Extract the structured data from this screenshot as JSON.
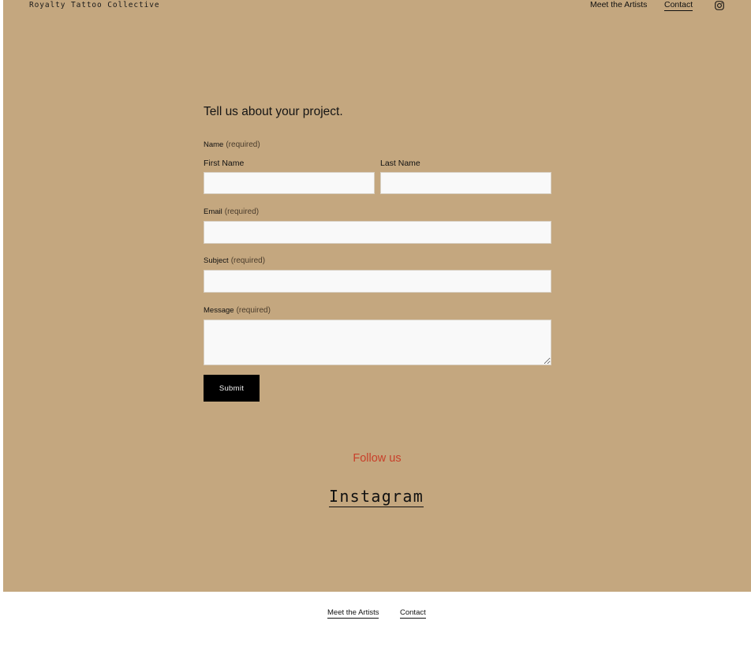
{
  "header": {
    "logo": "Royalty Tattoo Collective",
    "nav": {
      "artists": "Meet the Artists",
      "contact": "Contact"
    },
    "social_icon": "instagram-icon"
  },
  "form": {
    "title": "Tell us about your project.",
    "required_text": "(required)",
    "name": {
      "label": "Name",
      "first_label": "First Name",
      "last_label": "Last Name",
      "first_value": "",
      "last_value": ""
    },
    "email": {
      "label": "Email",
      "value": ""
    },
    "subject": {
      "label": "Subject",
      "value": ""
    },
    "message": {
      "label": "Message",
      "value": ""
    },
    "submit_label": "Submit"
  },
  "social": {
    "heading": "Follow us",
    "instagram_label": "Instagram"
  },
  "footer": {
    "artists": "Meet the Artists",
    "contact": "Contact"
  },
  "colors": {
    "background": "#c4a77f",
    "accent_heading": "#c8402a",
    "button": "#000000",
    "footer_background": "#ffffff",
    "field_background": "#f9f9f9"
  }
}
